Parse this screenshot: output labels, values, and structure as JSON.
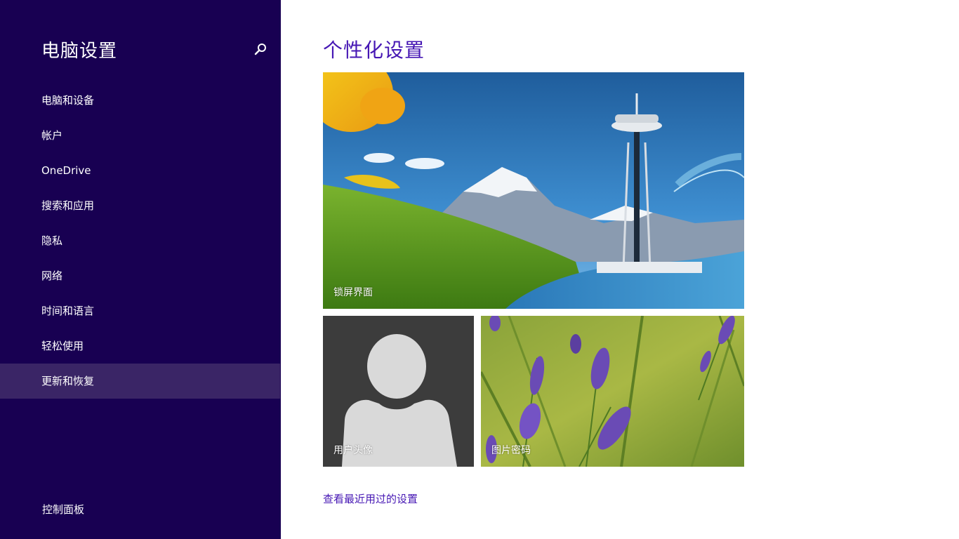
{
  "sidebar": {
    "title": "电脑设置",
    "search_icon": "search-icon",
    "items": [
      {
        "label": "电脑和设备",
        "selected": false
      },
      {
        "label": "帐户",
        "selected": false
      },
      {
        "label": "OneDrive",
        "selected": false
      },
      {
        "label": "搜索和应用",
        "selected": false
      },
      {
        "label": "隐私",
        "selected": false
      },
      {
        "label": "网络",
        "selected": false
      },
      {
        "label": "时间和语言",
        "selected": false
      },
      {
        "label": "轻松使用",
        "selected": false
      },
      {
        "label": "更新和恢复",
        "selected": true
      }
    ],
    "footer_link": "控制面板"
  },
  "main": {
    "title": "个性化设置",
    "tiles": {
      "lock_screen": "锁屏界面",
      "account_picture": "用户头像",
      "picture_password": "图片密码"
    },
    "recent_link": "查看最近用过的设置"
  },
  "colors": {
    "sidebar_bg": "#180052",
    "sidebar_selected": "#3a2566",
    "accent": "#4617b4"
  }
}
